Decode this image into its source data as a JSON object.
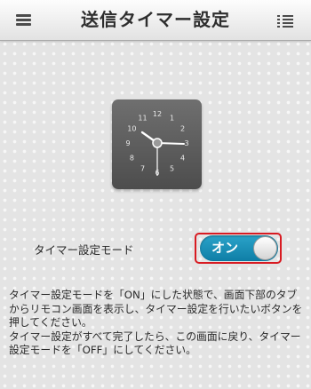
{
  "header": {
    "title": "送信タイマー設定",
    "menu_icon": "hamburger-menu-icon",
    "list_icon": "list-icon"
  },
  "clock": {
    "icon": "clock-icon",
    "numbers": [
      "12",
      "1",
      "2",
      "3",
      "4",
      "5",
      "6",
      "7",
      "8",
      "9",
      "10",
      "11"
    ]
  },
  "timer_mode": {
    "label": "タイマー設定モード",
    "toggle_label": "オン",
    "state": "on",
    "accent_color": "#1a8fb8",
    "highlight_color": "#d81b22"
  },
  "description": {
    "line1": "タイマー設定モードを「ON」にした状態で、画面下部のタブからリモコン画面を表示し、タイマー設定を行いたいボタンを押してください。",
    "line2": "タイマー設定がすべて完了したら、この画面に戻り、タイマー設定モードを「OFF」にしてください。"
  }
}
